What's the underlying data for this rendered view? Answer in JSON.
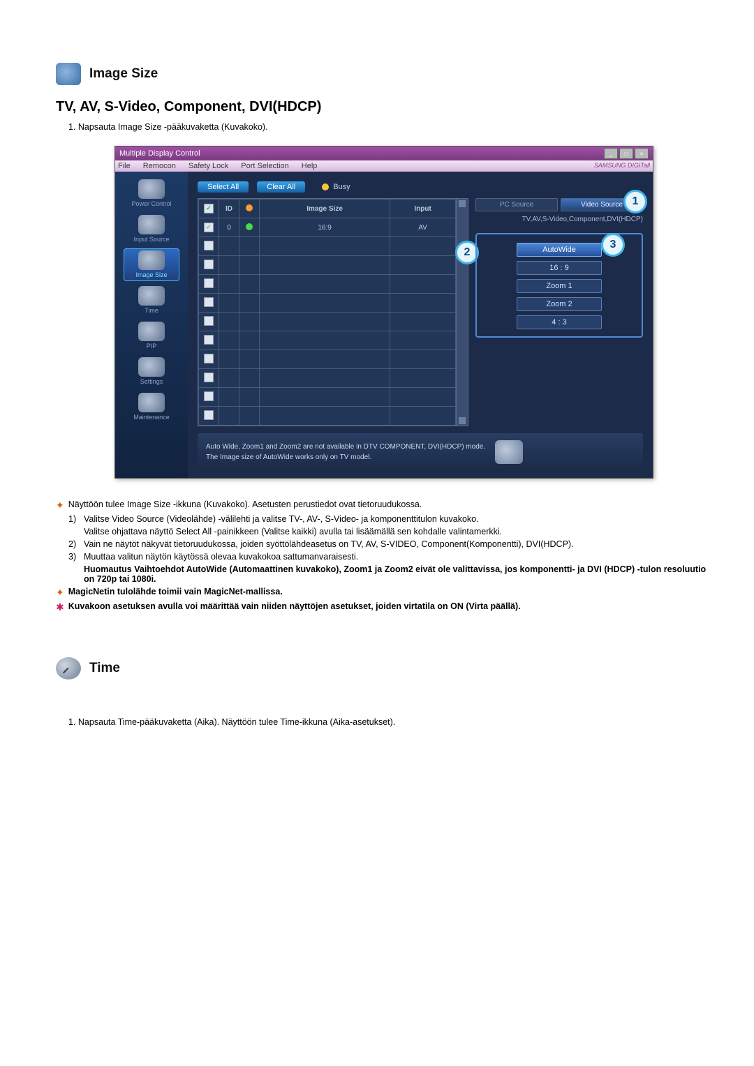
{
  "section1": {
    "title": "Image Size",
    "subheading": "TV, AV, S-Video, Component, DVI(HDCP)",
    "intro": "1.  Napsauta Image Size -pääkuvaketta (Kuvakoko)."
  },
  "app": {
    "title": "Multiple Display Control",
    "brand": "SAMSUNG DIGITall",
    "menu": [
      "File",
      "Remocon",
      "Safety Lock",
      "Port Selection",
      "Help"
    ],
    "sidebar": [
      {
        "label": "Power Control"
      },
      {
        "label": "Input Source"
      },
      {
        "label": "Image Size",
        "selected": true
      },
      {
        "label": "Time"
      },
      {
        "label": "PIP"
      },
      {
        "label": "Settings"
      },
      {
        "label": "Maintenance"
      }
    ],
    "buttons": {
      "select_all": "Select All",
      "clear_all": "Clear All",
      "busy": "Busy"
    },
    "grid": {
      "cols": [
        "",
        "ID",
        "",
        "Image Size",
        "Input"
      ],
      "row1": {
        "id": "0",
        "size": "16:9",
        "input": "AV"
      }
    },
    "tabs": {
      "pc": "PC Source",
      "video": "Video Source"
    },
    "group_label": "TV,AV,S-Video,Component,DVI(HDCP)",
    "options": [
      "AutoWide",
      "16 : 9",
      "Zoom 1",
      "Zoom 2",
      "4 : 3"
    ],
    "note1": "Auto Wide, Zoom1 and Zoom2 are not available in DTV COMPONENT, DVI(HDCP) mode.",
    "note2": "The Image size of AutoWide works only on TV model.",
    "badges": {
      "b1": "1",
      "b2": "2",
      "b3": "3"
    }
  },
  "notes": {
    "star1": "Näyttöön tulee Image Size -ikkuna (Kuvakoko). Asetusten perustiedot ovat tietoruudukossa.",
    "n1a": "Valitse Video Source (Videolähde) -välilehti ja valitse TV-, AV-, S-Video- ja komponenttitulon kuvakoko.",
    "n1b": "Valitse ohjattava näyttö Select All -painikkeen (Valitse kaikki) avulla tai lisäämällä sen kohdalle valintamerkki.",
    "n2": "Vain ne näytöt näkyvät tietoruudukossa, joiden syöttölähdeasetus on TV, AV, S-VIDEO, Component(Komponentti), DVI(HDCP).",
    "n3": "Muuttaa valitun näytön käytössä olevaa kuvakokoa sattumanvaraisesti.",
    "n3b": "Huomautus Vaihtoehdot AutoWide (Automaattinen kuvakoko), Zoom1 ja Zoom2 eivät ole valittavissa, jos komponentti- ja DVI (HDCP) -tulon resoluutio on 720p tai 1080i.",
    "star2": "MagicNetin tulolähde toimii vain MagicNet-mallissa.",
    "star3": "Kuvakoon asetuksen avulla voi määrittää vain niiden näyttöjen asetukset, joiden virtatila on ON (Virta päällä)."
  },
  "section2": {
    "title": "Time",
    "line1": "1.  Napsauta Time-pääkuvaketta (Aika). Näyttöön tulee Time-ikkuna (Aika-asetukset)."
  }
}
